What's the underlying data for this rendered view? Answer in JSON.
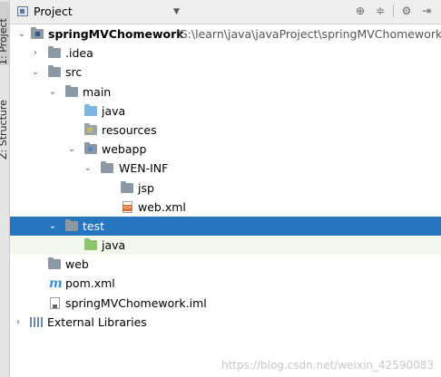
{
  "sidebar": {
    "tabs": [
      {
        "label": "1: Project"
      },
      {
        "label": "Z: Structure"
      }
    ]
  },
  "toolbar": {
    "title": "Project",
    "dropdown_icon": "chevron-down-icon",
    "buttons": [
      "target-icon",
      "collapse-icon",
      "gear-icon",
      "hide-icon"
    ]
  },
  "tree": {
    "root": {
      "name": "springMVChomework",
      "path": "G:\\learn\\java\\javaProject\\springMVChomework"
    },
    "items": [
      {
        "label": ".idea"
      },
      {
        "label": "src"
      },
      {
        "label": "main"
      },
      {
        "label": "java"
      },
      {
        "label": "resources"
      },
      {
        "label": "webapp"
      },
      {
        "label": "WEN-INF"
      },
      {
        "label": "jsp"
      },
      {
        "label": "web.xml"
      },
      {
        "label": "test"
      },
      {
        "label": "java"
      },
      {
        "label": "web"
      },
      {
        "label": "pom.xml"
      },
      {
        "label": "springMVChomework.iml"
      },
      {
        "label": "External Libraries"
      }
    ]
  },
  "watermark": "https://blog.csdn.net/weixin_42590083",
  "colors": {
    "selection": "#2675bf",
    "hover_row": "#f2f9ec",
    "source_folder": "#7eb6e2",
    "test_folder": "#8cc46c"
  }
}
